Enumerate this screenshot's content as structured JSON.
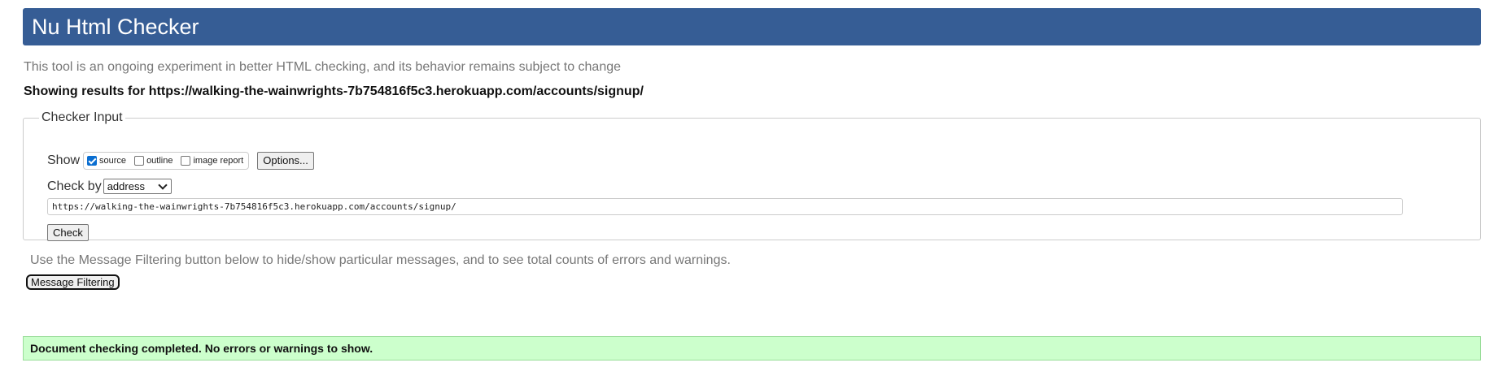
{
  "header": {
    "title": "Nu Html Checker"
  },
  "intro": "This tool is an ongoing experiment in better HTML checking, and its behavior remains subject to change",
  "results_heading": "Showing results for https://walking-the-wainwrights-7b754816f5c3.herokuapp.com/accounts/signup/",
  "checker_input": {
    "legend": "Checker Input",
    "show_label": "Show",
    "options": [
      {
        "label": "source",
        "checked": true
      },
      {
        "label": "outline",
        "checked": false
      },
      {
        "label": "image report",
        "checked": false
      }
    ],
    "options_button": "Options...",
    "check_by_label": "Check by",
    "check_by_value": "address",
    "url_value": "https://walking-the-wainwrights-7b754816f5c3.herokuapp.com/accounts/signup/",
    "check_button": "Check"
  },
  "filtering": {
    "text": "Use the Message Filtering button below to hide/show particular messages, and to see total counts of errors and warnings.",
    "button": "Message Filtering"
  },
  "status": {
    "message": "Document checking completed. No errors or warnings to show."
  },
  "colors": {
    "header_bg": "#365d95",
    "success_bg": "#ccffcc"
  }
}
